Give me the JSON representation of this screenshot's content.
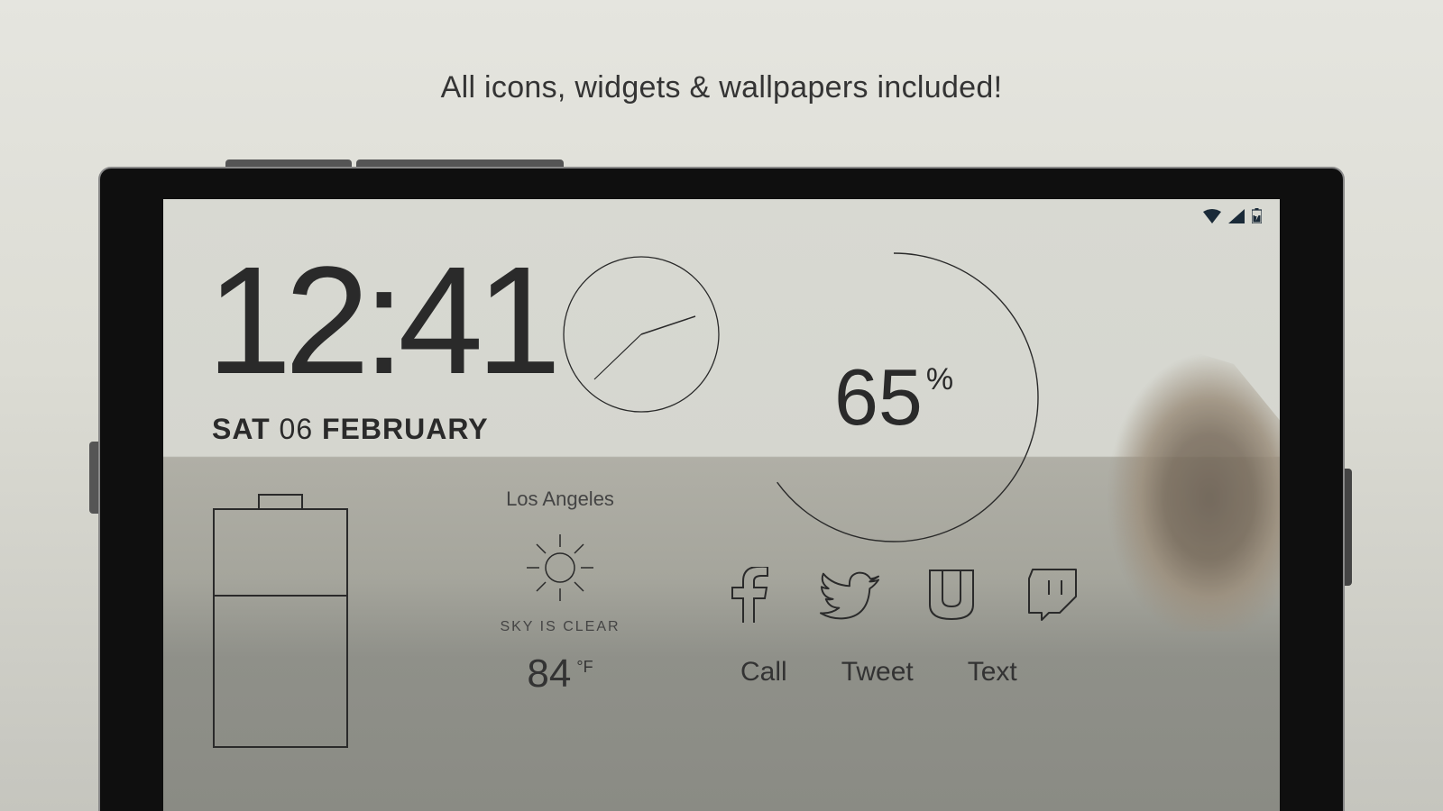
{
  "headline": "All icons, widgets & wallpapers included!",
  "clock": {
    "time": "12:41",
    "day": "SAT",
    "date_num": "06",
    "month": "FEBRUARY"
  },
  "battery_ring": {
    "value": "65",
    "unit": "%"
  },
  "weather": {
    "city": "Los Angeles",
    "condition": "SKY IS CLEAR",
    "temp": "84",
    "unit": "°F"
  },
  "shortcuts": {
    "a": "Call",
    "b": "Tweet",
    "c": "Text"
  },
  "icons": {
    "facebook": "facebook-icon",
    "twitter": "twitter-icon",
    "uber": "uber-icon",
    "twitch": "twitch-icon",
    "sun": "sun-icon",
    "battery": "battery-icon",
    "analog": "analog-clock-icon",
    "wifi": "wifi-icon",
    "cell": "cell-signal-icon",
    "charge": "battery-charge-icon"
  }
}
